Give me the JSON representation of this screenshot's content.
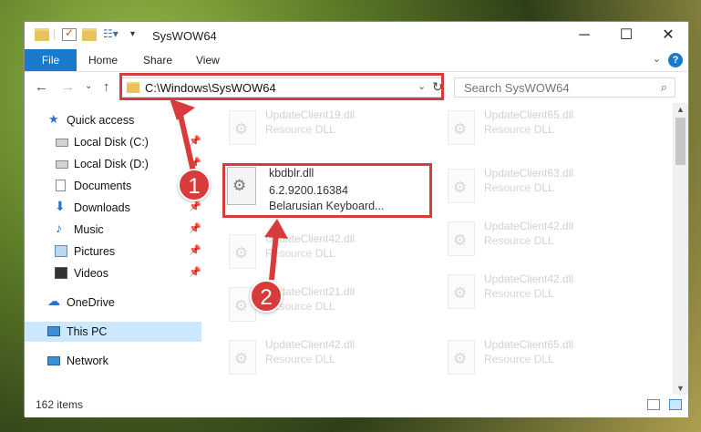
{
  "window": {
    "title": "SysWOW64"
  },
  "ribbon": {
    "file": "File",
    "home": "Home",
    "share": "Share",
    "view": "View",
    "help": "?"
  },
  "window_controls": {
    "minimize": "─",
    "maximize": "☐",
    "close": "✕"
  },
  "address": {
    "path": "C:\\Windows\\SysWOW64"
  },
  "search": {
    "placeholder": "Search SysWOW64"
  },
  "sidebar": {
    "items": [
      {
        "label": "Quick access",
        "icon": "star-icon",
        "pinned": false
      },
      {
        "label": "Local Disk (C:)",
        "icon": "drive-icon",
        "pinned": true
      },
      {
        "label": "Local Disk (D:)",
        "icon": "drive-icon",
        "pinned": true
      },
      {
        "label": "Documents",
        "icon": "documents-icon",
        "pinned": true
      },
      {
        "label": "Downloads",
        "icon": "downloads-icon",
        "pinned": true
      },
      {
        "label": "Music",
        "icon": "music-icon",
        "pinned": true
      },
      {
        "label": "Pictures",
        "icon": "pictures-icon",
        "pinned": true
      },
      {
        "label": "Videos",
        "icon": "videos-icon",
        "pinned": true
      },
      {
        "label": "OneDrive",
        "icon": "cloud-icon",
        "pinned": false
      },
      {
        "label": "This PC",
        "icon": "computer-icon",
        "pinned": false,
        "selected": true
      },
      {
        "label": "Network",
        "icon": "network-icon",
        "pinned": false
      }
    ]
  },
  "files": {
    "left": [
      {
        "name": "UpdateClient19.dll",
        "type": "Resource DLL"
      },
      {
        "name": "kbdblr.dll",
        "version": "6.2.9200.16384",
        "description": "Belarusian Keyboard...",
        "highlighted": true
      },
      {
        "name": "UpdateClient42.dll",
        "type": "Resource DLL"
      },
      {
        "name": "UpdateClient21.dll",
        "type": "Resource DLL"
      },
      {
        "name": "UpdateClient42.dll",
        "type": "Resource DLL"
      }
    ],
    "right": [
      {
        "name": "UpdateClient65.dll",
        "type": "Resource DLL"
      },
      {
        "name": "UpdateClient63.dll",
        "type": "Resource DLL"
      },
      {
        "name": "UpdateClient42.dll",
        "type": "Resource DLL"
      },
      {
        "name": "UpdateClient42.dll",
        "type": "Resource DLL"
      },
      {
        "name": "UpdateClient65.dll",
        "type": "Resource DLL"
      }
    ]
  },
  "status": {
    "item_count": "162 items"
  },
  "annotations": {
    "callout_1": "1",
    "callout_2": "2",
    "highlight_color": "#d83b3b"
  },
  "colors": {
    "accent": "#1979ca",
    "selection": "#cce8ff"
  }
}
